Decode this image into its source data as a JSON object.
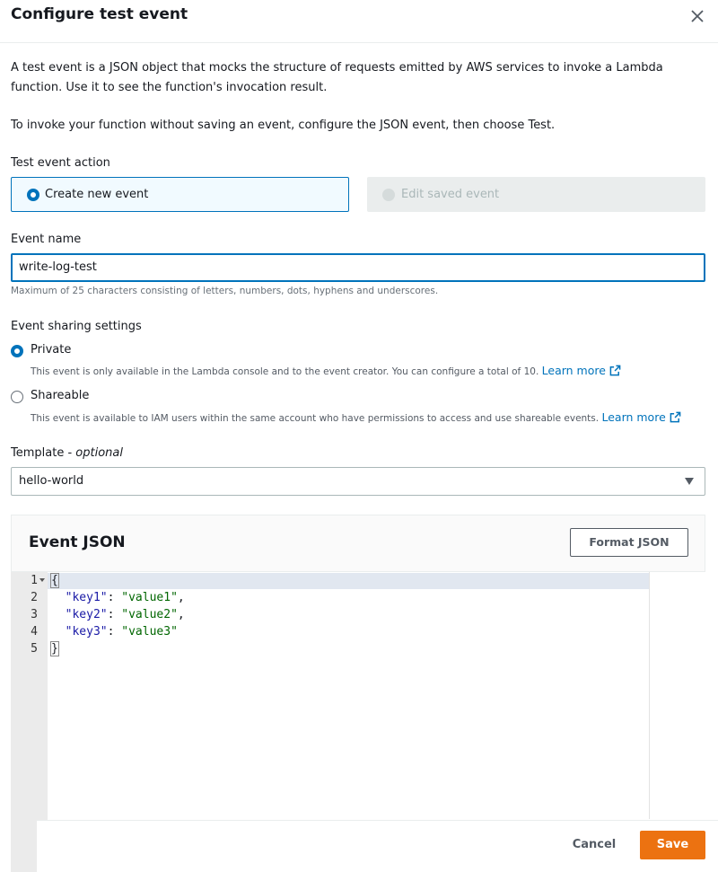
{
  "modal": {
    "title": "Configure test event"
  },
  "intro": {
    "paragraph1": "A test event is a JSON object that mocks the structure of requests emitted by AWS services to invoke a Lambda function. Use it to see the function's invocation result.",
    "paragraph2": "To invoke your function without saving an event, configure the JSON event, then choose Test."
  },
  "test_event_action": {
    "label": "Test event action",
    "options": [
      {
        "label": "Create new event",
        "selected": true,
        "disabled": false
      },
      {
        "label": "Edit saved event",
        "selected": false,
        "disabled": true
      }
    ]
  },
  "event_name": {
    "label": "Event name",
    "value": "write-log-test",
    "hint": "Maximum of 25 characters consisting of letters, numbers, dots, hyphens and underscores."
  },
  "sharing": {
    "label": "Event sharing settings",
    "options": [
      {
        "label": "Private",
        "selected": true,
        "description": "This event is only available in the Lambda console and to the event creator. You can configure a total of 10.",
        "link": "Learn more"
      },
      {
        "label": "Shareable",
        "selected": false,
        "description": "This event is available to IAM users within the same account who have permissions to access and use shareable events.",
        "link": "Learn more"
      }
    ]
  },
  "template": {
    "label": "Template - ",
    "label_suffix": "optional",
    "selected": "hello-world"
  },
  "event_json": {
    "title": "Event JSON",
    "format_button": "Format JSON",
    "lines": [
      {
        "num": "1",
        "text": "{"
      },
      {
        "num": "2",
        "key": "\"key1\"",
        "value": "\"value1\"",
        "trail": ","
      },
      {
        "num": "3",
        "key": "\"key2\"",
        "value": "\"value2\"",
        "trail": ","
      },
      {
        "num": "4",
        "key": "\"key3\"",
        "value": "\"value3\"",
        "trail": ""
      },
      {
        "num": "5",
        "text": "}"
      }
    ]
  },
  "footer": {
    "cancel_label": "Cancel",
    "save_label": "Save"
  },
  "colors": {
    "accent": "#0073bb",
    "primary_button": "#ec7211"
  }
}
